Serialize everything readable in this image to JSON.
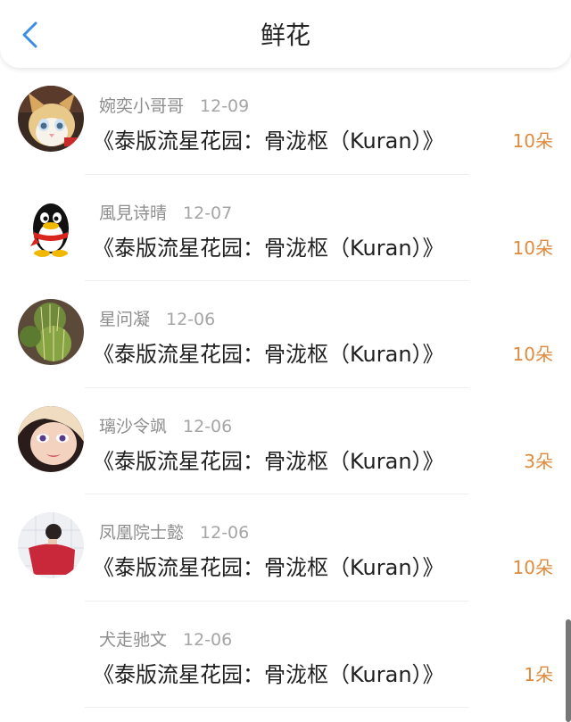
{
  "header": {
    "title": "鲜花",
    "back_icon": "chevron-left-icon",
    "accent_color": "#3a8ee6"
  },
  "items": [
    {
      "avatar": "cat-avatar",
      "name": "婉奕小哥哥",
      "date": "12-09",
      "gift": "《泰版流星花园：骨泷枢（Kuran）》",
      "count": "10朵"
    },
    {
      "avatar": "penguin-avatar",
      "name": "風見诗晴",
      "date": "12-07",
      "gift": "《泰版流星花园：骨泷枢（Kuran）》",
      "count": "10朵"
    },
    {
      "avatar": "cactus-avatar",
      "name": "星问凝",
      "date": "12-06",
      "gift": "《泰版流星花园：骨泷枢（Kuran）》",
      "count": "10朵"
    },
    {
      "avatar": "face-avatar",
      "name": "璃沙令飒",
      "date": "12-06",
      "gift": "《泰版流星花园：骨泷枢（Kuran）》",
      "count": "3朵"
    },
    {
      "avatar": "girl-photo-avatar",
      "name": "凤凰院士懿",
      "date": "12-06",
      "gift": "《泰版流星花园：骨泷枢（Kuran）》",
      "count": "10朵"
    },
    {
      "avatar": "",
      "name": "犬走驰文",
      "date": "12-06",
      "gift": "《泰版流星花园：骨泷枢（Kuran）》",
      "count": "1朵"
    }
  ],
  "colors": {
    "count": "#e08a3c",
    "name": "#8d8d8d",
    "text": "#1f1f1f"
  }
}
